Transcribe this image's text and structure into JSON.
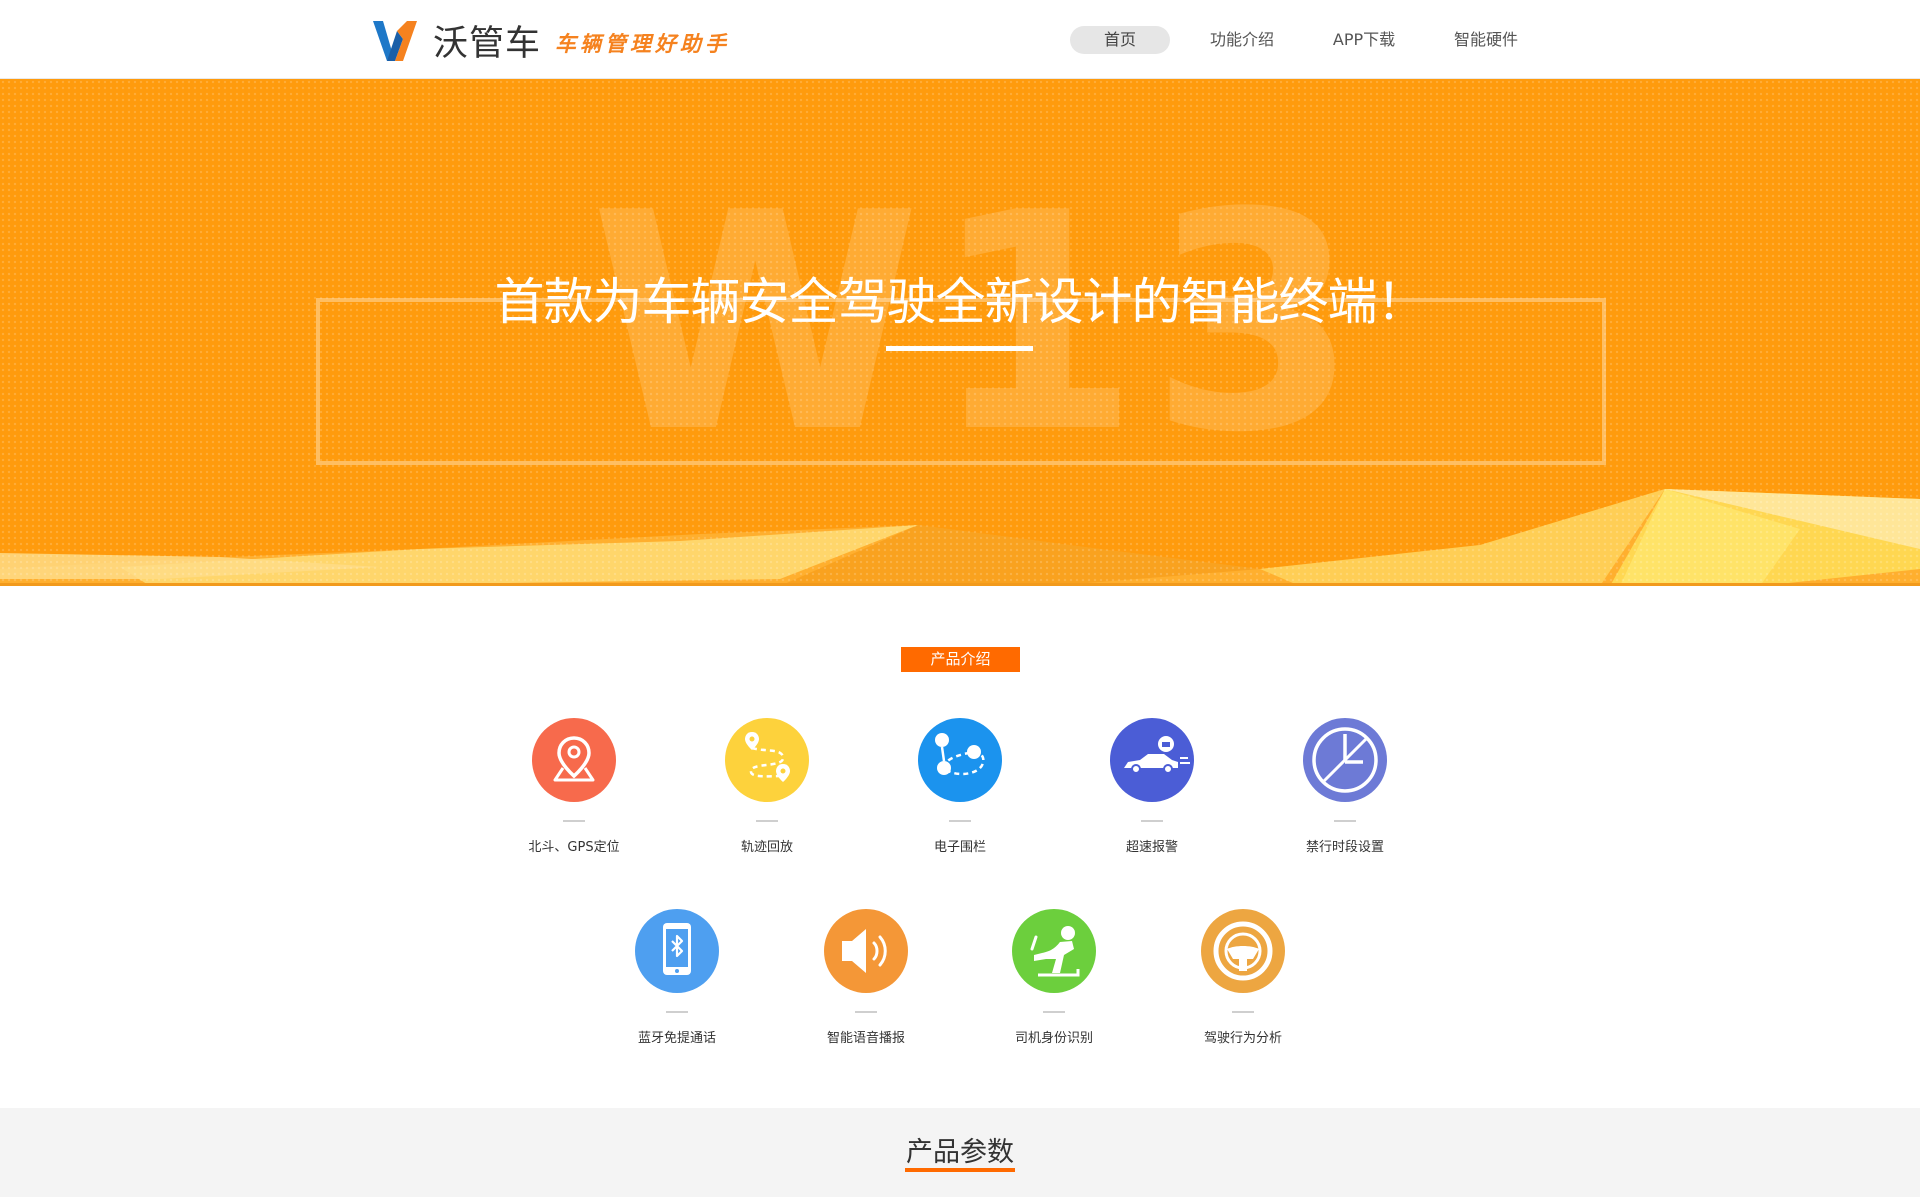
{
  "header": {
    "brand_name": "沃管车",
    "slogan": "车辆管理好助手",
    "logo_colors": {
      "blue": "#1e78c8",
      "orange": "#f5821f"
    }
  },
  "nav": {
    "items": [
      {
        "label": "首页",
        "active": true
      },
      {
        "label": "功能介绍",
        "active": false
      },
      {
        "label": "APP下载",
        "active": false
      },
      {
        "label": "智能硬件",
        "active": false
      }
    ]
  },
  "hero": {
    "watermark": "W13",
    "headline": "首款为车辆安全驾驶全新设计的智能终端！",
    "background_color": "#ff9b0d"
  },
  "intro": {
    "badge": "产品介绍",
    "features": [
      {
        "label": "北斗、GPS定位",
        "icon": "location-pin-icon",
        "color": "#f76a4c"
      },
      {
        "label": "轨迹回放",
        "icon": "route-icon",
        "color": "#fdd23c"
      },
      {
        "label": "电子围栏",
        "icon": "geofence-icon",
        "color": "#1b93ee"
      },
      {
        "label": "超速报警",
        "icon": "speeding-car-icon",
        "color": "#4b5dd6"
      },
      {
        "label": "禁行时段设置",
        "icon": "clock-icon",
        "color": "#6d7ad6"
      },
      {
        "label": "蓝牙免提通话",
        "icon": "bluetooth-phone-icon",
        "color": "#4e9ff0"
      },
      {
        "label": "智能语音播报",
        "icon": "speaker-icon",
        "color": "#f49737"
      },
      {
        "label": "司机身份识别",
        "icon": "driver-seat-icon",
        "color": "#6ccf3d"
      },
      {
        "label": "驾驶行为分析",
        "icon": "steering-wheel-icon",
        "color": "#eda641"
      }
    ]
  },
  "params": {
    "title": "产品参数",
    "accent": "#ff6a00"
  }
}
